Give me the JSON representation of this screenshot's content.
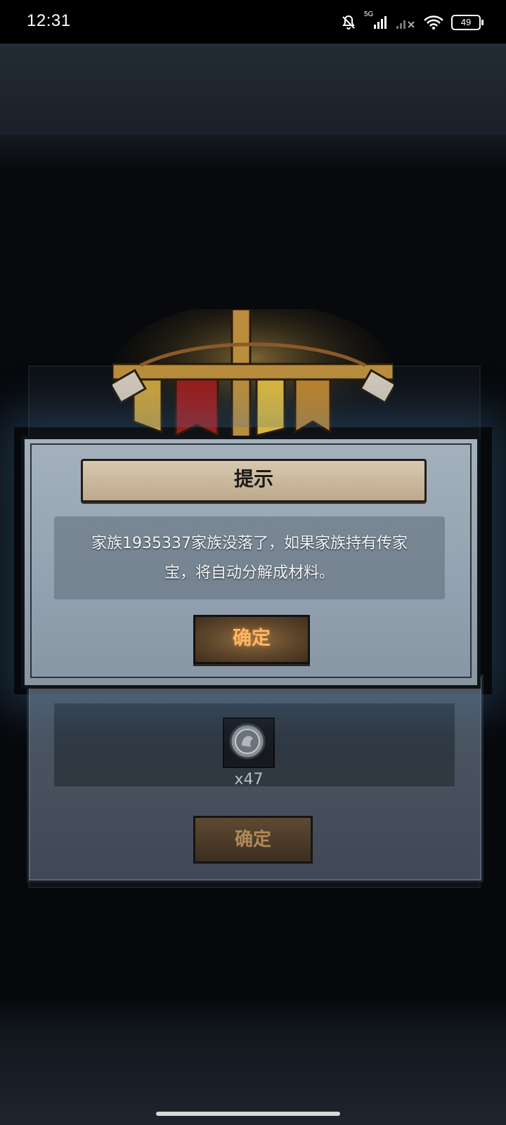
{
  "status_bar": {
    "time": "12:31",
    "battery": "49",
    "network_label": "5G"
  },
  "dialog": {
    "title": "提示",
    "message_line1": "家族1935337家族没落了，如果家族持有传家",
    "message_line2": "宝，将自动分解成材料。",
    "confirm_label": "确定"
  },
  "reward_panel": {
    "item_icon": "silver-coin-icon",
    "item_count": "x47",
    "confirm_label": "确定"
  },
  "colors": {
    "dialog_bg": "#9aa8b6",
    "title_banner": "#cbb89c",
    "button_text": "#ffb765"
  }
}
